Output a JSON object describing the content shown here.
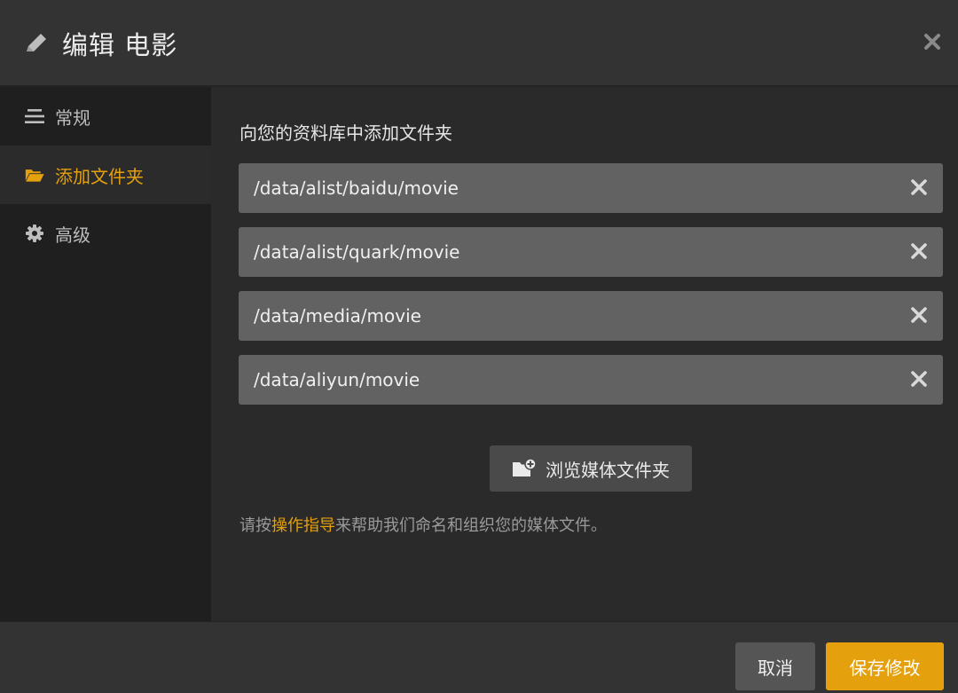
{
  "dialog": {
    "title": "编辑 电影"
  },
  "sidebar": {
    "items": [
      {
        "label": "常规",
        "icon": "list-lines-icon"
      },
      {
        "label": "添加文件夹",
        "icon": "folder-open-icon",
        "active": true
      },
      {
        "label": "高级",
        "icon": "gear-icon"
      }
    ]
  },
  "main": {
    "section_label": "向您的资料库中添加文件夹",
    "folders": [
      "/data/alist/baidu/movie",
      "/data/alist/quark/movie",
      "/data/media/movie",
      "/data/aliyun/movie"
    ],
    "browse_label": "浏览媒体文件夹",
    "hint_prefix": "请按",
    "hint_link": "操作指导",
    "hint_suffix": "来帮助我们命名和组织您的媒体文件。"
  },
  "footer": {
    "cancel_label": "取消",
    "save_label": "保存修改"
  },
  "colors": {
    "accent": "#e5a00d",
    "row_bg": "#626262",
    "sidebar_bg": "#1f1f1f"
  }
}
